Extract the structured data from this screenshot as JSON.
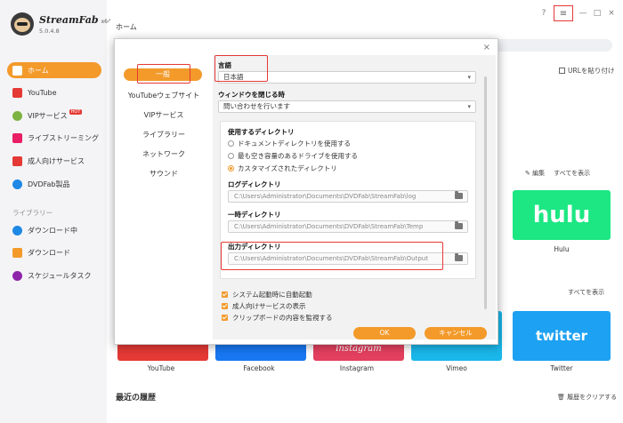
{
  "app": {
    "name": "StreamFab",
    "arch": "x64",
    "version": "5.0.4.8"
  },
  "sidebar": {
    "items": [
      {
        "label": "ホーム",
        "icon": "home-icon",
        "color": "#f39a2b"
      },
      {
        "label": "YouTube",
        "icon": "youtube-icon",
        "color": "#e53935"
      },
      {
        "label": "VIPサービス",
        "icon": "key-icon",
        "color": "#7cb342",
        "badge": "HOT"
      },
      {
        "label": "ライブストリーミング",
        "icon": "live-icon",
        "color": "#e91e63"
      },
      {
        "label": "成人向けサービス",
        "icon": "adult-icon",
        "color": "#e53935"
      },
      {
        "label": "DVDFab製品",
        "icon": "dvdfab-icon",
        "color": "#1e88e5"
      }
    ],
    "library_label": "ライブラリー",
    "library_items": [
      {
        "label": "ダウンロード中",
        "icon": "download-icon",
        "color": "#1e88e5"
      },
      {
        "label": "ダウンロード",
        "icon": "folder-icon",
        "color": "#f39a2b"
      },
      {
        "label": "スケジュールタスク",
        "icon": "schedule-icon",
        "color": "#8e24aa"
      }
    ]
  },
  "main": {
    "tab_label": "ホーム",
    "url_paste": "URLを貼り付け",
    "edit": "編集",
    "show_all": "すべてを表示",
    "tiles": [
      {
        "name": "YouTube",
        "color": "#e53935"
      },
      {
        "name": "Facebook",
        "color": "#1877f2"
      },
      {
        "name": "Instagram",
        "color": "#e4405f"
      },
      {
        "name": "Vimeo",
        "color": "#1ab7ea"
      },
      {
        "name": "Twitter",
        "color": "#1da1f2"
      }
    ],
    "hulu": {
      "logo": "hulu",
      "label": "Hulu"
    },
    "twitter_logo": "twitter",
    "instagram_logo_text": "instagram",
    "recent_title": "最近の履歴",
    "clear_history": "履歴をクリアする"
  },
  "settings": {
    "nav": [
      "一般",
      "YouTubeウェブサイト",
      "VIPサービス",
      "ライブラリー",
      "ネットワーク",
      "サウンド"
    ],
    "language": {
      "label": "言語",
      "value": "日本語"
    },
    "window_close": {
      "label": "ウィンドウを閉じる時",
      "value": "問い合わせを行います"
    },
    "directory": {
      "label": "使用するディレクトリ",
      "options": [
        {
          "label": "ドキュメントディレクトリを使用する",
          "selected": false
        },
        {
          "label": "最も空き容量のあるドライブを使用する",
          "selected": false
        },
        {
          "label": "カスタマイズされたディレクトリ",
          "selected": true
        }
      ],
      "log_label": "ログディレクトリ",
      "log_path": "C:\\Users\\Administrator\\Documents\\DVDFab\\StreamFab\\log",
      "temp_label": "一時ディレクトリ",
      "temp_path": "C:\\Users\\Administrator\\Documents\\DVDFab\\StreamFab\\Temp",
      "output_label": "出力ディレクトリ",
      "output_path": "C:\\Users\\Administrator\\Documents\\DVDFab\\StreamFab\\Output"
    },
    "checkboxes": [
      {
        "label": "システム起動時に自動起動",
        "checked": true
      },
      {
        "label": "成人向けサービスの表示",
        "checked": true
      },
      {
        "label": "クリップボードの内容を監視する",
        "checked": true
      }
    ],
    "ok_label": "OK",
    "cancel_label": "キャンセル",
    "close_glyph": "×"
  },
  "window": {
    "help_glyph": "?",
    "menu_glyph": "≡",
    "min_glyph": "—",
    "max_glyph": "□",
    "close_glyph": "×"
  },
  "colors": {
    "accent": "#f39a2b",
    "highlight": "#e53935"
  }
}
